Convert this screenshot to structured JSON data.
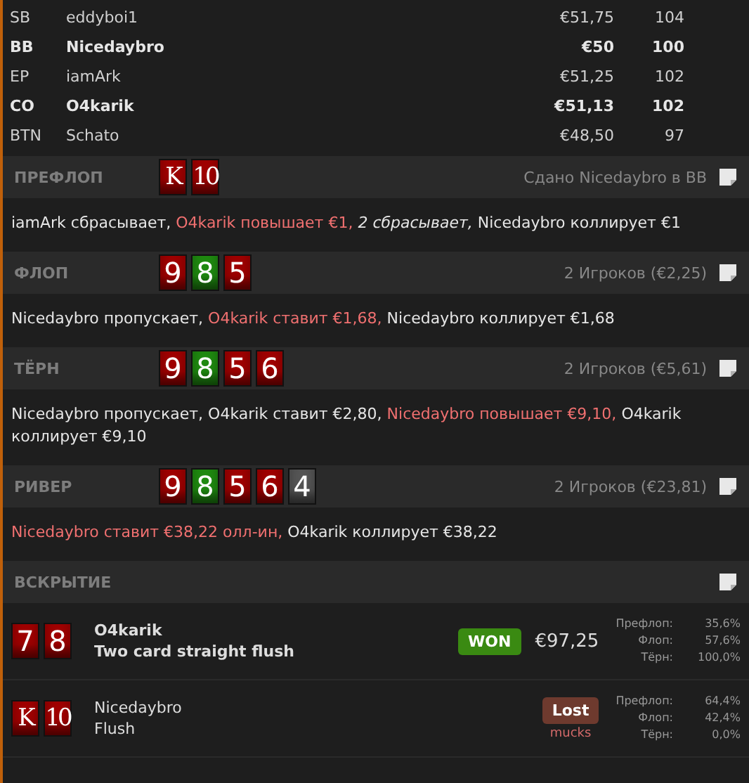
{
  "players": [
    {
      "position": "SB",
      "name": "eddyboi1",
      "stack": "€51,75",
      "bb": "104",
      "bold": false
    },
    {
      "position": "BB",
      "name": "Nicedaybro",
      "stack": "€50",
      "bb": "100",
      "bold": true
    },
    {
      "position": "EP",
      "name": "iamArk",
      "stack": "€51,25",
      "bb": "102",
      "bold": false
    },
    {
      "position": "CO",
      "name": "O4karik",
      "stack": "€51,13",
      "bb": "102",
      "bold": true
    },
    {
      "position": "BTN",
      "name": "Schato",
      "stack": "€48,50",
      "bb": "97",
      "bold": false
    }
  ],
  "streets": [
    {
      "label": "ПРЕФЛОП",
      "info": "Сдано Nicedaybro в BB",
      "cards": [
        {
          "rank": "K",
          "color": "#a00000"
        },
        {
          "rank": "10",
          "color": "#a00000"
        }
      ],
      "actions": [
        {
          "text": "iamArk сбрасывает,",
          "highlight": false,
          "italic": false
        },
        {
          "text": "O4karik повышает €1,",
          "highlight": true,
          "italic": false
        },
        {
          "text": "2 сбрасывает,",
          "highlight": false,
          "italic": true
        },
        {
          "text": "Nicedaybro коллирует €1",
          "highlight": false,
          "italic": false
        }
      ]
    },
    {
      "label": "ФЛОП",
      "info": "2 Игроков (€2,25)",
      "cards": [
        {
          "rank": "9",
          "color": "#a00000"
        },
        {
          "rank": "8",
          "color": "#1f8a10"
        },
        {
          "rank": "5",
          "color": "#a00000"
        }
      ],
      "actions": [
        {
          "text": "Nicedaybro пропускает,",
          "highlight": false,
          "italic": false
        },
        {
          "text": "O4karik ставит €1,68,",
          "highlight": true,
          "italic": false
        },
        {
          "text": "Nicedaybro коллирует €1,68",
          "highlight": false,
          "italic": false
        }
      ]
    },
    {
      "label": "ТЁРН",
      "info": "2 Игроков (€5,61)",
      "cards": [
        {
          "rank": "9",
          "color": "#a00000"
        },
        {
          "rank": "8",
          "color": "#1f8a10"
        },
        {
          "rank": "5",
          "color": "#a00000"
        },
        {
          "rank": "6",
          "color": "#a00000"
        }
      ],
      "actions": [
        {
          "text": "Nicedaybro пропускает,",
          "highlight": false,
          "italic": false
        },
        {
          "text": "O4karik ставит €2,80,",
          "highlight": false,
          "italic": false
        },
        {
          "text": "Nicedaybro повышает €9,10,",
          "highlight": true,
          "italic": false
        },
        {
          "text": "O4karik коллирует €9,10",
          "highlight": false,
          "italic": false
        }
      ]
    },
    {
      "label": "РИВЕР",
      "info": "2 Игроков (€23,81)",
      "cards": [
        {
          "rank": "9",
          "color": "#a00000"
        },
        {
          "rank": "8",
          "color": "#1f8a10"
        },
        {
          "rank": "5",
          "color": "#a00000"
        },
        {
          "rank": "6",
          "color": "#a00000"
        },
        {
          "rank": "4",
          "color": "#555555"
        }
      ],
      "actions": [
        {
          "text": "Nicedaybro ставит €38,22 олл-ин,",
          "highlight": true,
          "italic": false
        },
        {
          "text": "O4karik коллирует €38,22",
          "highlight": false,
          "italic": false
        }
      ]
    }
  ],
  "showdown": {
    "label": "ВСКРЫТИЕ",
    "hands": [
      {
        "cards": [
          {
            "rank": "7",
            "color": "#a00000"
          },
          {
            "rank": "8",
            "color": "#a00000"
          }
        ],
        "name": "O4karik",
        "hand": "Two card straight flush",
        "bold": true,
        "won": true,
        "badge": "WON",
        "amount": "€97,25",
        "stats": [
          {
            "label": "Префлоп:",
            "value": "35,6%"
          },
          {
            "label": "Флоп:",
            "value": "57,6%"
          },
          {
            "label": "Тёрн:",
            "value": "100,0%"
          }
        ]
      },
      {
        "cards": [
          {
            "rank": "K",
            "color": "#a00000"
          },
          {
            "rank": "10",
            "color": "#a00000"
          }
        ],
        "name": "Nicedaybro",
        "hand": "Flush",
        "bold": false,
        "won": false,
        "badge": "Lost",
        "note": "mucks",
        "stats": [
          {
            "label": "Префлоп:",
            "value": "64,4%"
          },
          {
            "label": "Флоп:",
            "value": "42,4%"
          },
          {
            "label": "Тёрн:",
            "value": "0,0%"
          }
        ]
      }
    ]
  }
}
